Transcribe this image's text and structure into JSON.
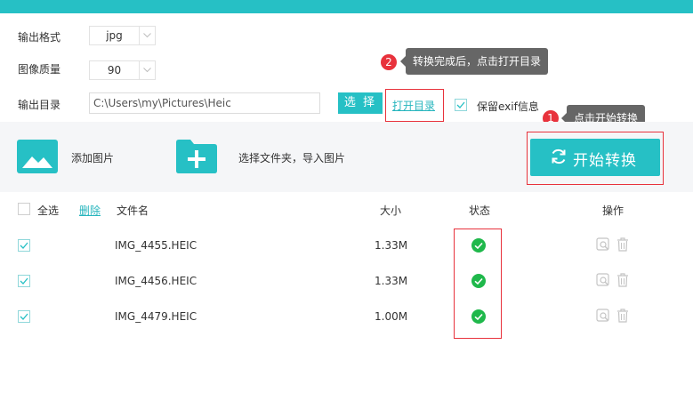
{
  "settings": {
    "format_label": "输出格式",
    "format_value": "jpg",
    "quality_label": "图像质量",
    "quality_value": "90",
    "dir_label": "输出目录",
    "dir_value": "C:\\Users\\my\\Pictures\\Heic",
    "choose_button": "选 择",
    "open_dir_link": "打开目录",
    "keep_exif_label": "保留exif信息",
    "keep_exif_checked": true
  },
  "tips": {
    "tip2_badge": "2",
    "tip2_text": "转换完成后，点击打开目录",
    "tip1_badge": "1",
    "tip1_text": "点击开始转换"
  },
  "toolbar": {
    "add_image_label": "添加图片",
    "add_folder_label": "选择文件夹，导入图片",
    "start_button": "开始转换",
    "accent_color": "#26c0c5"
  },
  "table": {
    "select_all": "全选",
    "delete_link": "删除",
    "columns": {
      "name": "文件名",
      "size": "大小",
      "status": "状态",
      "actions": "操作"
    },
    "rows": [
      {
        "name": "IMG_4455.HEIC",
        "size": "1.33M",
        "status": "done",
        "checked": true
      },
      {
        "name": "IMG_4456.HEIC",
        "size": "1.33M",
        "status": "done",
        "checked": true
      },
      {
        "name": "IMG_4479.HEIC",
        "size": "1.00M",
        "status": "done",
        "checked": true
      }
    ]
  },
  "icons": {
    "add_image": "image-icon",
    "add_folder": "folder-plus-icon",
    "start": "refresh-icon",
    "status_ok": "check-circle-icon",
    "preview": "preview-icon",
    "delete": "trash-icon"
  }
}
